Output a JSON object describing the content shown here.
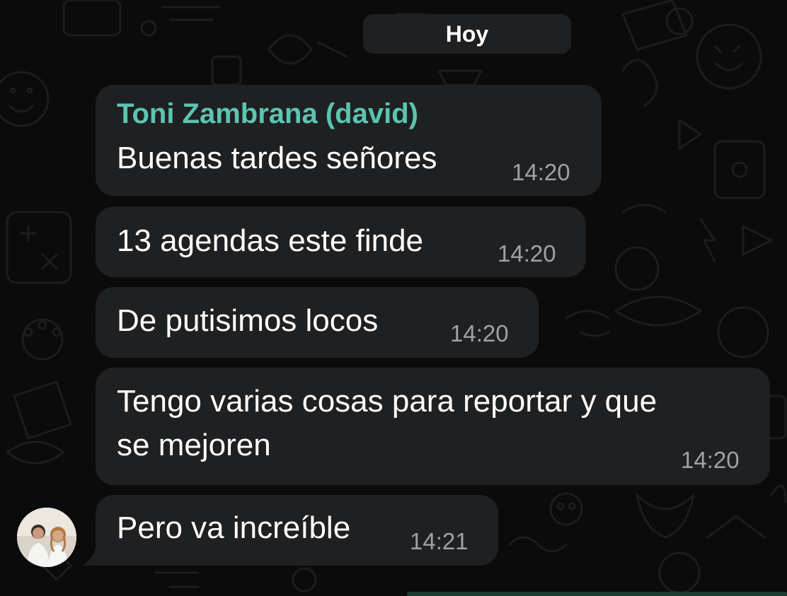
{
  "date_separator": "Hoy",
  "sender_name": "Toni Zambrana (david)",
  "colors": {
    "background": "#0b0b0b",
    "bubble": "#1f2022",
    "sender_name": "#5cc4b0",
    "message_text": "#ffffff",
    "timestamp": "#9ea2a6"
  },
  "messages": [
    {
      "text": "Buenas tardes señores",
      "time": "14:20"
    },
    {
      "text": "13 agendas este finde",
      "time": "14:20"
    },
    {
      "text": "De putisimos locos",
      "time": "14:20"
    },
    {
      "text": "Tengo varias cosas para reportar y que\nse mejoren",
      "time": "14:20"
    },
    {
      "text": "Pero va increíble",
      "time": "14:21"
    }
  ]
}
